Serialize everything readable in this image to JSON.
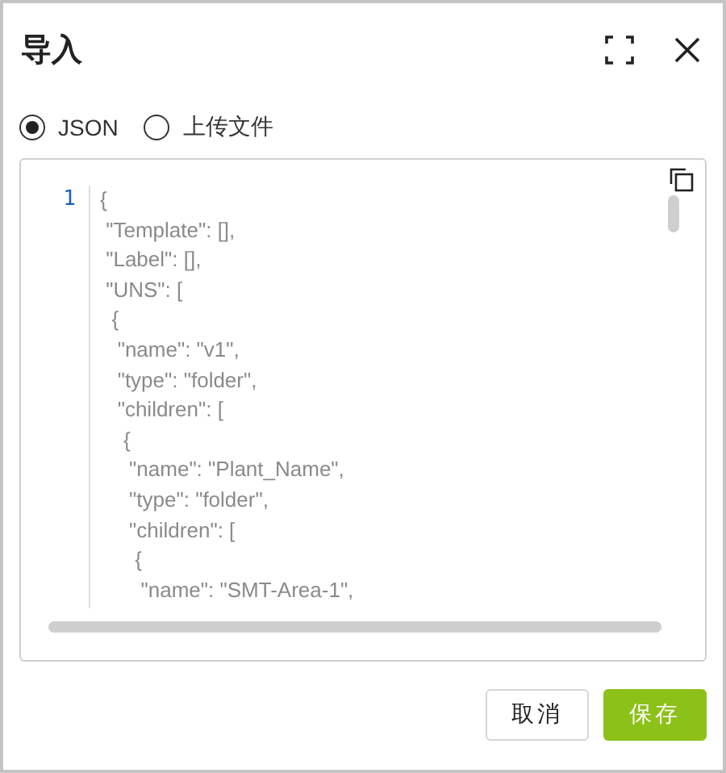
{
  "dialog": {
    "title": "导入"
  },
  "source_options": [
    {
      "label": "JSON",
      "selected": true
    },
    {
      "label": "上传文件",
      "selected": false
    }
  ],
  "editor": {
    "line_numbers": [
      "1"
    ],
    "lines": [
      "{",
      " \"Template\": [],",
      " \"Label\": [],",
      " \"UNS\": [",
      "  {",
      "   \"name\": \"v1\",",
      "   \"type\": \"folder\",",
      "   \"children\": [",
      "    {",
      "     \"name\": \"Plant_Name\",",
      "     \"type\": \"folder\",",
      "     \"children\": [",
      "      {",
      "       \"name\": \"SMT-Area-1\","
    ]
  },
  "buttons": [
    {
      "label": "取消",
      "kind": "secondary"
    },
    {
      "label": "保存",
      "kind": "primary"
    }
  ]
}
